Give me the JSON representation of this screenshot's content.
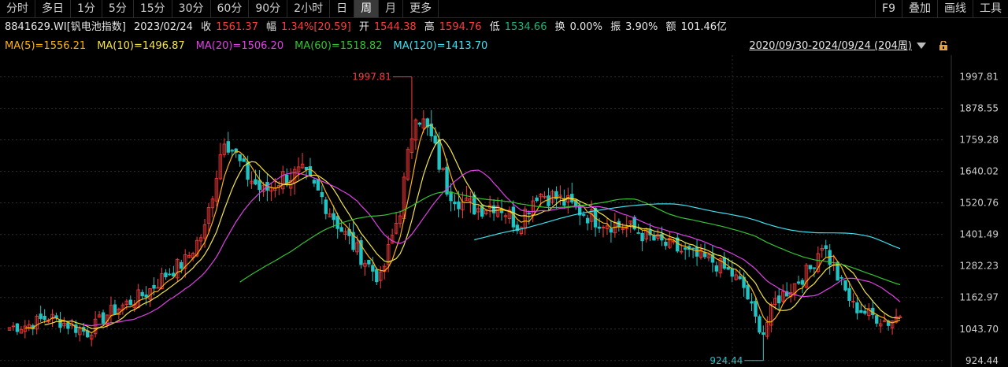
{
  "toolbar": {
    "periods": [
      "分时",
      "多日",
      "1分",
      "5分",
      "15分",
      "30分",
      "60分",
      "90分",
      "2小时",
      "日",
      "周",
      "月",
      "更多"
    ],
    "active_period": "周",
    "tools": [
      "F9",
      "叠加",
      "画线",
      "工具"
    ]
  },
  "info": {
    "code_name": "8841629.WI[钒电池指数]",
    "date": "2023/02/24",
    "close_label": "收",
    "close": "1561.37",
    "range_label": "幅",
    "change": "1.34%[20.59]",
    "open_label": "开",
    "open": "1544.38",
    "high_label": "高",
    "high": "1594.76",
    "low_label": "低",
    "low": "1534.66",
    "turnover_label": "换",
    "turnover": "0.00%",
    "amplitude_label": "振",
    "amplitude": "3.90%",
    "amount_label": "额",
    "amount": "101.46亿"
  },
  "ma": [
    {
      "label": "MA(5)=1556.21",
      "color": "#ffb400"
    },
    {
      "label": "MA(10)=1496.87",
      "color": "#f5e642"
    },
    {
      "label": "MA(20)=1506.20",
      "color": "#e040e6"
    },
    {
      "label": "MA(60)=1518.82",
      "color": "#33c233"
    },
    {
      "label": "MA(120)=1413.70",
      "color": "#3fe0f0"
    }
  ],
  "range_text": "2020/09/30-2024/09/24 (204周)",
  "colors": {
    "up": "#ff3b3b",
    "down": "#21c3c3",
    "grid": "#2e2e2e"
  },
  "chart_data": {
    "type": "candlestick",
    "y_ticks": [
      1997.81,
      1878.55,
      1759.28,
      1640.02,
      1520.76,
      1401.49,
      1282.23,
      1162.97,
      1043.7,
      924.44
    ],
    "ylim": [
      900,
      2080
    ],
    "annotations": [
      {
        "label": "1997.81",
        "value": 1997.81,
        "type": "max",
        "index": 103
      },
      {
        "label": "924.44",
        "value": 924.44,
        "type": "min",
        "index": 193
      }
    ],
    "anchors": [
      [
        0,
        1050
      ],
      [
        5,
        1060
      ],
      [
        10,
        1090
      ],
      [
        15,
        1060
      ],
      [
        20,
        1030
      ],
      [
        25,
        1100
      ],
      [
        30,
        1140
      ],
      [
        35,
        1180
      ],
      [
        40,
        1250
      ],
      [
        45,
        1300
      ],
      [
        50,
        1420
      ],
      [
        55,
        1780
      ],
      [
        60,
        1640
      ],
      [
        65,
        1560
      ],
      [
        70,
        1620
      ],
      [
        75,
        1630
      ],
      [
        80,
        1540
      ],
      [
        85,
        1420
      ],
      [
        90,
        1320
      ],
      [
        95,
        1230
      ],
      [
        100,
        1500
      ],
      [
        104,
        1880
      ],
      [
        108,
        1760
      ],
      [
        112,
        1580
      ],
      [
        116,
        1520
      ],
      [
        120,
        1500
      ],
      [
        125,
        1520
      ],
      [
        130,
        1440
      ],
      [
        135,
        1560
      ],
      [
        140,
        1540
      ],
      [
        145,
        1500
      ],
      [
        150,
        1460
      ],
      [
        155,
        1440
      ],
      [
        160,
        1420
      ],
      [
        165,
        1380
      ],
      [
        170,
        1350
      ],
      [
        175,
        1320
      ],
      [
        180,
        1300
      ],
      [
        185,
        1250
      ],
      [
        188,
        1200
      ],
      [
        191,
        1080
      ],
      [
        193,
        1030
      ],
      [
        196,
        1150
      ],
      [
        200,
        1200
      ],
      [
        205,
        1270
      ],
      [
        208,
        1370
      ],
      [
        212,
        1240
      ],
      [
        216,
        1130
      ],
      [
        220,
        1100
      ],
      [
        225,
        1070
      ],
      [
        228,
        1100
      ]
    ],
    "candle_count": 229
  }
}
